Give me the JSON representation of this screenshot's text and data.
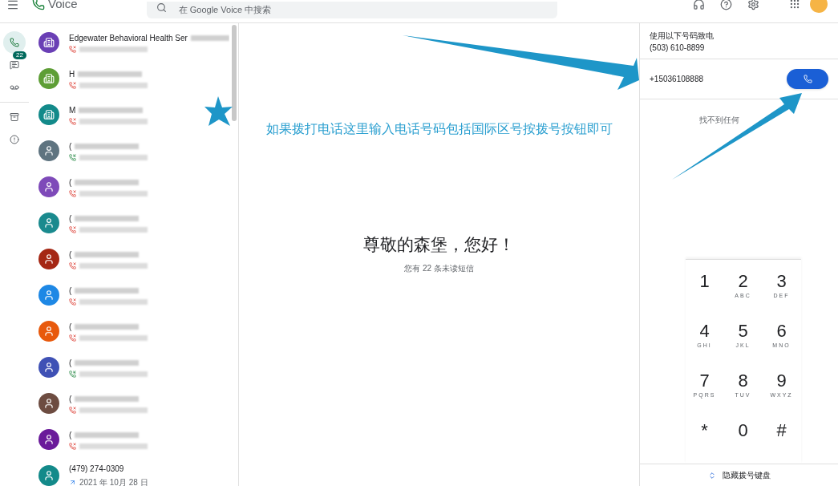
{
  "app": {
    "name": "Voice"
  },
  "search": {
    "placeholder": "在 Google Voice 中搜索"
  },
  "nav": [
    {
      "kind": "phone",
      "selected": true
    },
    {
      "kind": "message",
      "selected": false,
      "badge": "22"
    },
    {
      "kind": "voicemail",
      "selected": false
    },
    {
      "kind": "archive",
      "selected": false
    },
    {
      "kind": "spam",
      "selected": false
    }
  ],
  "contacts": [
    {
      "kind": "business",
      "color": "#6a3fb5",
      "name": "Edgewater Behavioral Health Ser",
      "call": {
        "kind": "missed"
      }
    },
    {
      "kind": "business",
      "color": "#5e9e36",
      "name": "H",
      "call": {
        "kind": "missed"
      }
    },
    {
      "kind": "business",
      "color": "#138a8a",
      "name": "M",
      "call": {
        "kind": "missed"
      }
    },
    {
      "kind": "person",
      "color": "#5f7480",
      "name": "(",
      "call": {
        "kind": "received"
      }
    },
    {
      "kind": "person",
      "color": "#7e4ab9",
      "name": "(",
      "call": {
        "kind": "missed"
      }
    },
    {
      "kind": "person",
      "color": "#1a8a8e",
      "name": "(",
      "call": {
        "kind": "missed"
      }
    },
    {
      "kind": "person",
      "color": "#a52714",
      "name": "(",
      "call": {
        "kind": "missed"
      }
    },
    {
      "kind": "person",
      "color": "#1e88e5",
      "name": "(",
      "call": {
        "kind": "missed"
      }
    },
    {
      "kind": "person",
      "color": "#e8590c",
      "name": "(",
      "call": {
        "kind": "missed"
      }
    },
    {
      "kind": "person",
      "color": "#3f51b5",
      "name": "(",
      "call": {
        "kind": "received"
      }
    },
    {
      "kind": "person",
      "color": "#6d4c41",
      "name": "(",
      "call": {
        "kind": "missed"
      }
    },
    {
      "kind": "person",
      "color": "#6a1b9a",
      "name": "(",
      "call": {
        "kind": "missed"
      }
    },
    {
      "kind": "person",
      "color": "#138a8a",
      "name": "(479) 274-0309",
      "call": {
        "kind": "outgoing"
      },
      "date": "2021 年 10月 28 日"
    }
  ],
  "annotation": {
    "text": "如果拨打电话这里输入电话号码包括国际区号按拨号按钮即可"
  },
  "greeting": {
    "title": "尊敬的森堡，您好！",
    "subtitle": "您有 22 条未读短信"
  },
  "dialer": {
    "caller_label": "使用以下号码致电",
    "caller_number": "(503) 610-8899",
    "entered_number": "+15036108888",
    "no_results": "找不到任何",
    "keys": [
      {
        "digit": "1"
      },
      {
        "digit": "2",
        "letters": "ABC"
      },
      {
        "digit": "3",
        "letters": "DEF"
      },
      {
        "digit": "4",
        "letters": "GHI"
      },
      {
        "digit": "5",
        "letters": "JKL"
      },
      {
        "digit": "6",
        "letters": "MNO"
      },
      {
        "digit": "7",
        "letters": "PQRS"
      },
      {
        "digit": "8",
        "letters": "TUV"
      },
      {
        "digit": "9",
        "letters": "WXYZ"
      },
      {
        "digit": "*"
      },
      {
        "digit": "0"
      },
      {
        "digit": "#"
      }
    ],
    "hide_keypad": "隐藏拨号键盘"
  }
}
